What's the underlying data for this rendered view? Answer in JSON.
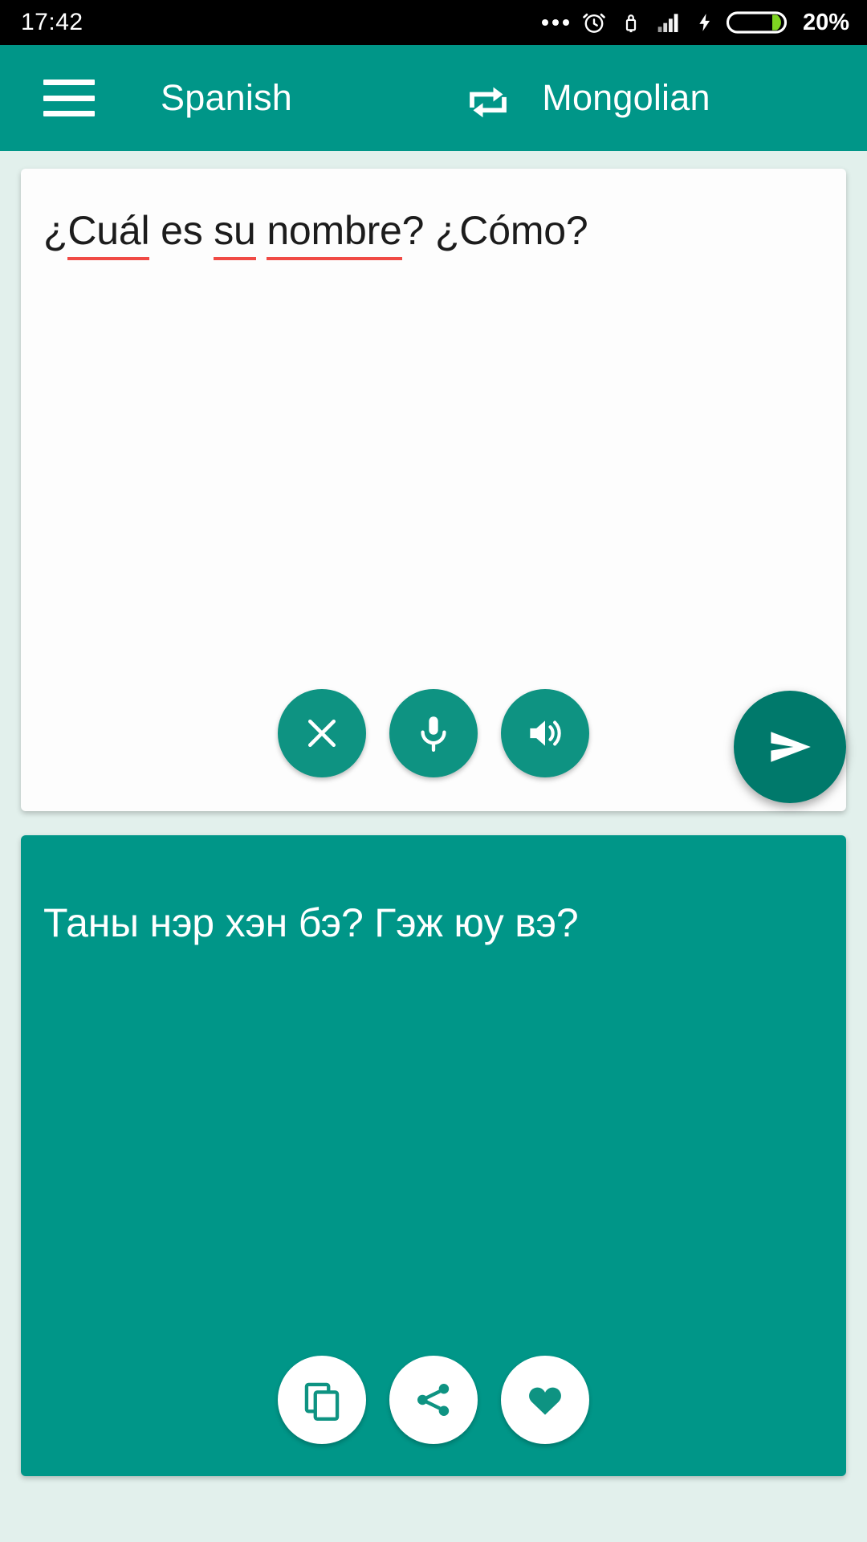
{
  "status_bar": {
    "time": "17:42",
    "battery_percent": "20%",
    "icons": [
      "more-dots-icon",
      "alarm-clock-icon",
      "usb-lock-icon",
      "signal-bars-icon",
      "charging-bolt-icon",
      "battery-icon"
    ]
  },
  "app_bar": {
    "menu_icon": "hamburger-menu-icon",
    "source_language": "Spanish",
    "swap_icon": "swap-languages-icon",
    "target_language": "Mongolian"
  },
  "input_card": {
    "text": "¿Cuál es su nombre? ¿Cómo?",
    "tokens": [
      {
        "text": "¿",
        "misspelled": false
      },
      {
        "text": "Cuál",
        "misspelled": true
      },
      {
        "text": " es ",
        "misspelled": false
      },
      {
        "text": "su",
        "misspelled": true
      },
      {
        "text": " ",
        "misspelled": false
      },
      {
        "text": "nombre",
        "misspelled": true
      },
      {
        "text": "? ¿Cómo?",
        "misspelled": false
      }
    ],
    "actions": [
      {
        "name": "clear-button",
        "icon": "close-icon"
      },
      {
        "name": "voice-input-button",
        "icon": "microphone-icon"
      },
      {
        "name": "speak-source-button",
        "icon": "speaker-icon"
      }
    ]
  },
  "output_card": {
    "text": "Таны нэр хэн бэ? Гэж юу вэ?",
    "actions": [
      {
        "name": "copy-button",
        "icon": "copy-icon"
      },
      {
        "name": "share-button",
        "icon": "share-icon"
      },
      {
        "name": "favorite-button",
        "icon": "heart-icon"
      }
    ]
  },
  "send_button": {
    "name": "translate-send-button",
    "icon": "send-icon"
  },
  "colors": {
    "primary": "#009688",
    "primary_dark": "#00796b",
    "background": "#e2f0ec",
    "card": "#fdfdfd",
    "spellcheck_underline": "#f04a45",
    "battery_fill": "#7ed321",
    "status_bar": "#000000"
  }
}
